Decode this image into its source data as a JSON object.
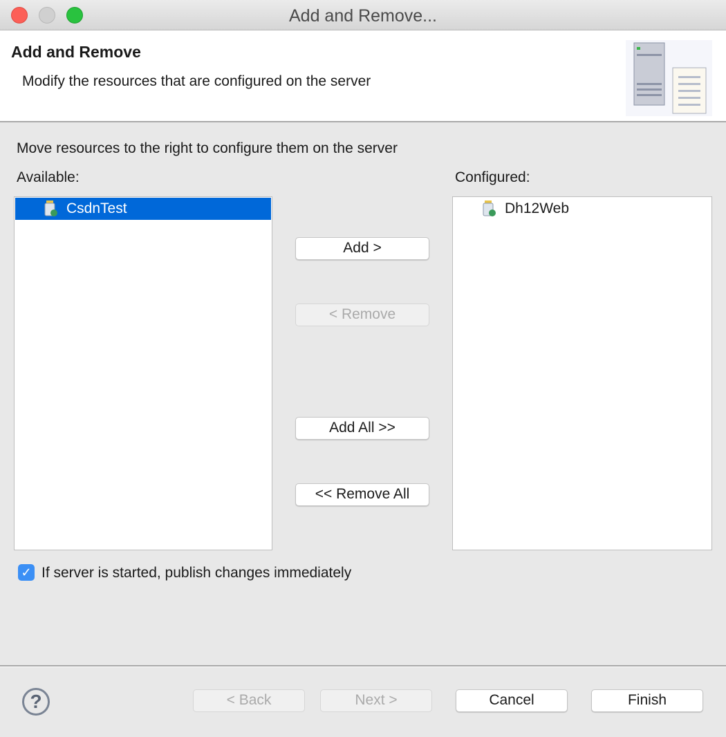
{
  "window": {
    "title": "Add and Remove..."
  },
  "header": {
    "title": "Add and Remove",
    "subtitle": "Modify the resources that are configured on the server"
  },
  "instructions": "Move resources to the right to configure them on the server",
  "available": {
    "label": "Available:",
    "items": [
      {
        "name": "CsdnTest",
        "selected": true
      }
    ]
  },
  "configured": {
    "label": "Configured:",
    "items": [
      {
        "name": "Dh12Web",
        "selected": false
      }
    ]
  },
  "buttons": {
    "add": "Add >",
    "remove": "< Remove",
    "add_all": "Add All >>",
    "remove_all": "<< Remove All"
  },
  "publish_checkbox": {
    "label": "If server is started, publish changes immediately",
    "checked": true
  },
  "footer": {
    "back": "< Back",
    "next": "Next >",
    "cancel": "Cancel",
    "finish": "Finish"
  },
  "colors": {
    "selection": "#0068d9",
    "checkbox": "#3b8ff5"
  }
}
